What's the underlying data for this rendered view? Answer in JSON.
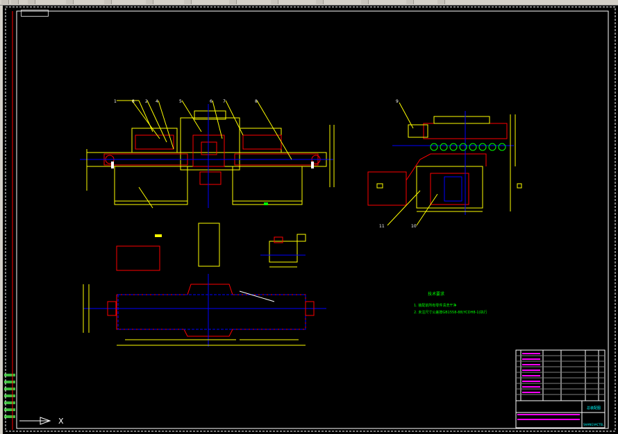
{
  "app": {
    "tab_label": "",
    "toolbar_title": ""
  },
  "drawing": {
    "tech_notes": {
      "title": "技术要求",
      "line1": "1. 装配前所有零件清洗干净",
      "line2": "2. 未注尺寸公差按GB1558-88(YCDH8-1)执行"
    },
    "callouts": [
      "1",
      "8",
      "2",
      "4",
      "5",
      "6",
      "7",
      "8",
      "9",
      "11",
      "10"
    ],
    "title_block": {
      "company": "SHANGVACTEL",
      "title_text": "总装配图"
    },
    "ucs_icon_label": "X"
  },
  "colors": {
    "background": "#000000",
    "frame": "#ffffff",
    "outline": "#ffff00",
    "part": "#ff0000",
    "centerline": "#0000ff",
    "dimension": "#ffff00",
    "gear": "#00ff00",
    "notes": "#00ff00",
    "title_block": "#ff00ff"
  },
  "icons": [
    "ucs-axis-icon",
    "layer-swatch-icon"
  ]
}
